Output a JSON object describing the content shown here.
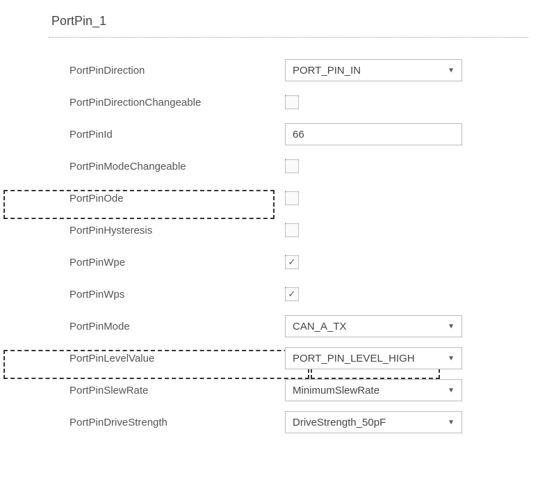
{
  "title": "PortPin_1",
  "rows": [
    {
      "label": "PortPinDirection",
      "type": "dropdown",
      "value": "PORT_PIN_IN"
    },
    {
      "label": "PortPinDirectionChangeable",
      "type": "checkbox",
      "checked": false
    },
    {
      "label": "PortPinId",
      "type": "text",
      "value": "66"
    },
    {
      "label": "PortPinModeChangeable",
      "type": "checkbox",
      "checked": false
    },
    {
      "label": "PortPinOde",
      "type": "checkbox",
      "checked": false
    },
    {
      "label": "PortPinHysteresis",
      "type": "checkbox",
      "checked": false
    },
    {
      "label": "PortPinWpe",
      "type": "checkbox",
      "checked": true
    },
    {
      "label": "PortPinWps",
      "type": "checkbox",
      "checked": true
    },
    {
      "label": "PortPinMode",
      "type": "dropdown",
      "value": "CAN_A_TX"
    },
    {
      "label": "PortPinLevelValue",
      "type": "dropdown",
      "value": "PORT_PIN_LEVEL_HIGH"
    },
    {
      "label": "PortPinSlewRate",
      "type": "dropdown",
      "value": "MinimumSlewRate"
    },
    {
      "label": "PortPinDriveStrength",
      "type": "dropdown",
      "value": "DriveStrength_50pF"
    }
  ]
}
